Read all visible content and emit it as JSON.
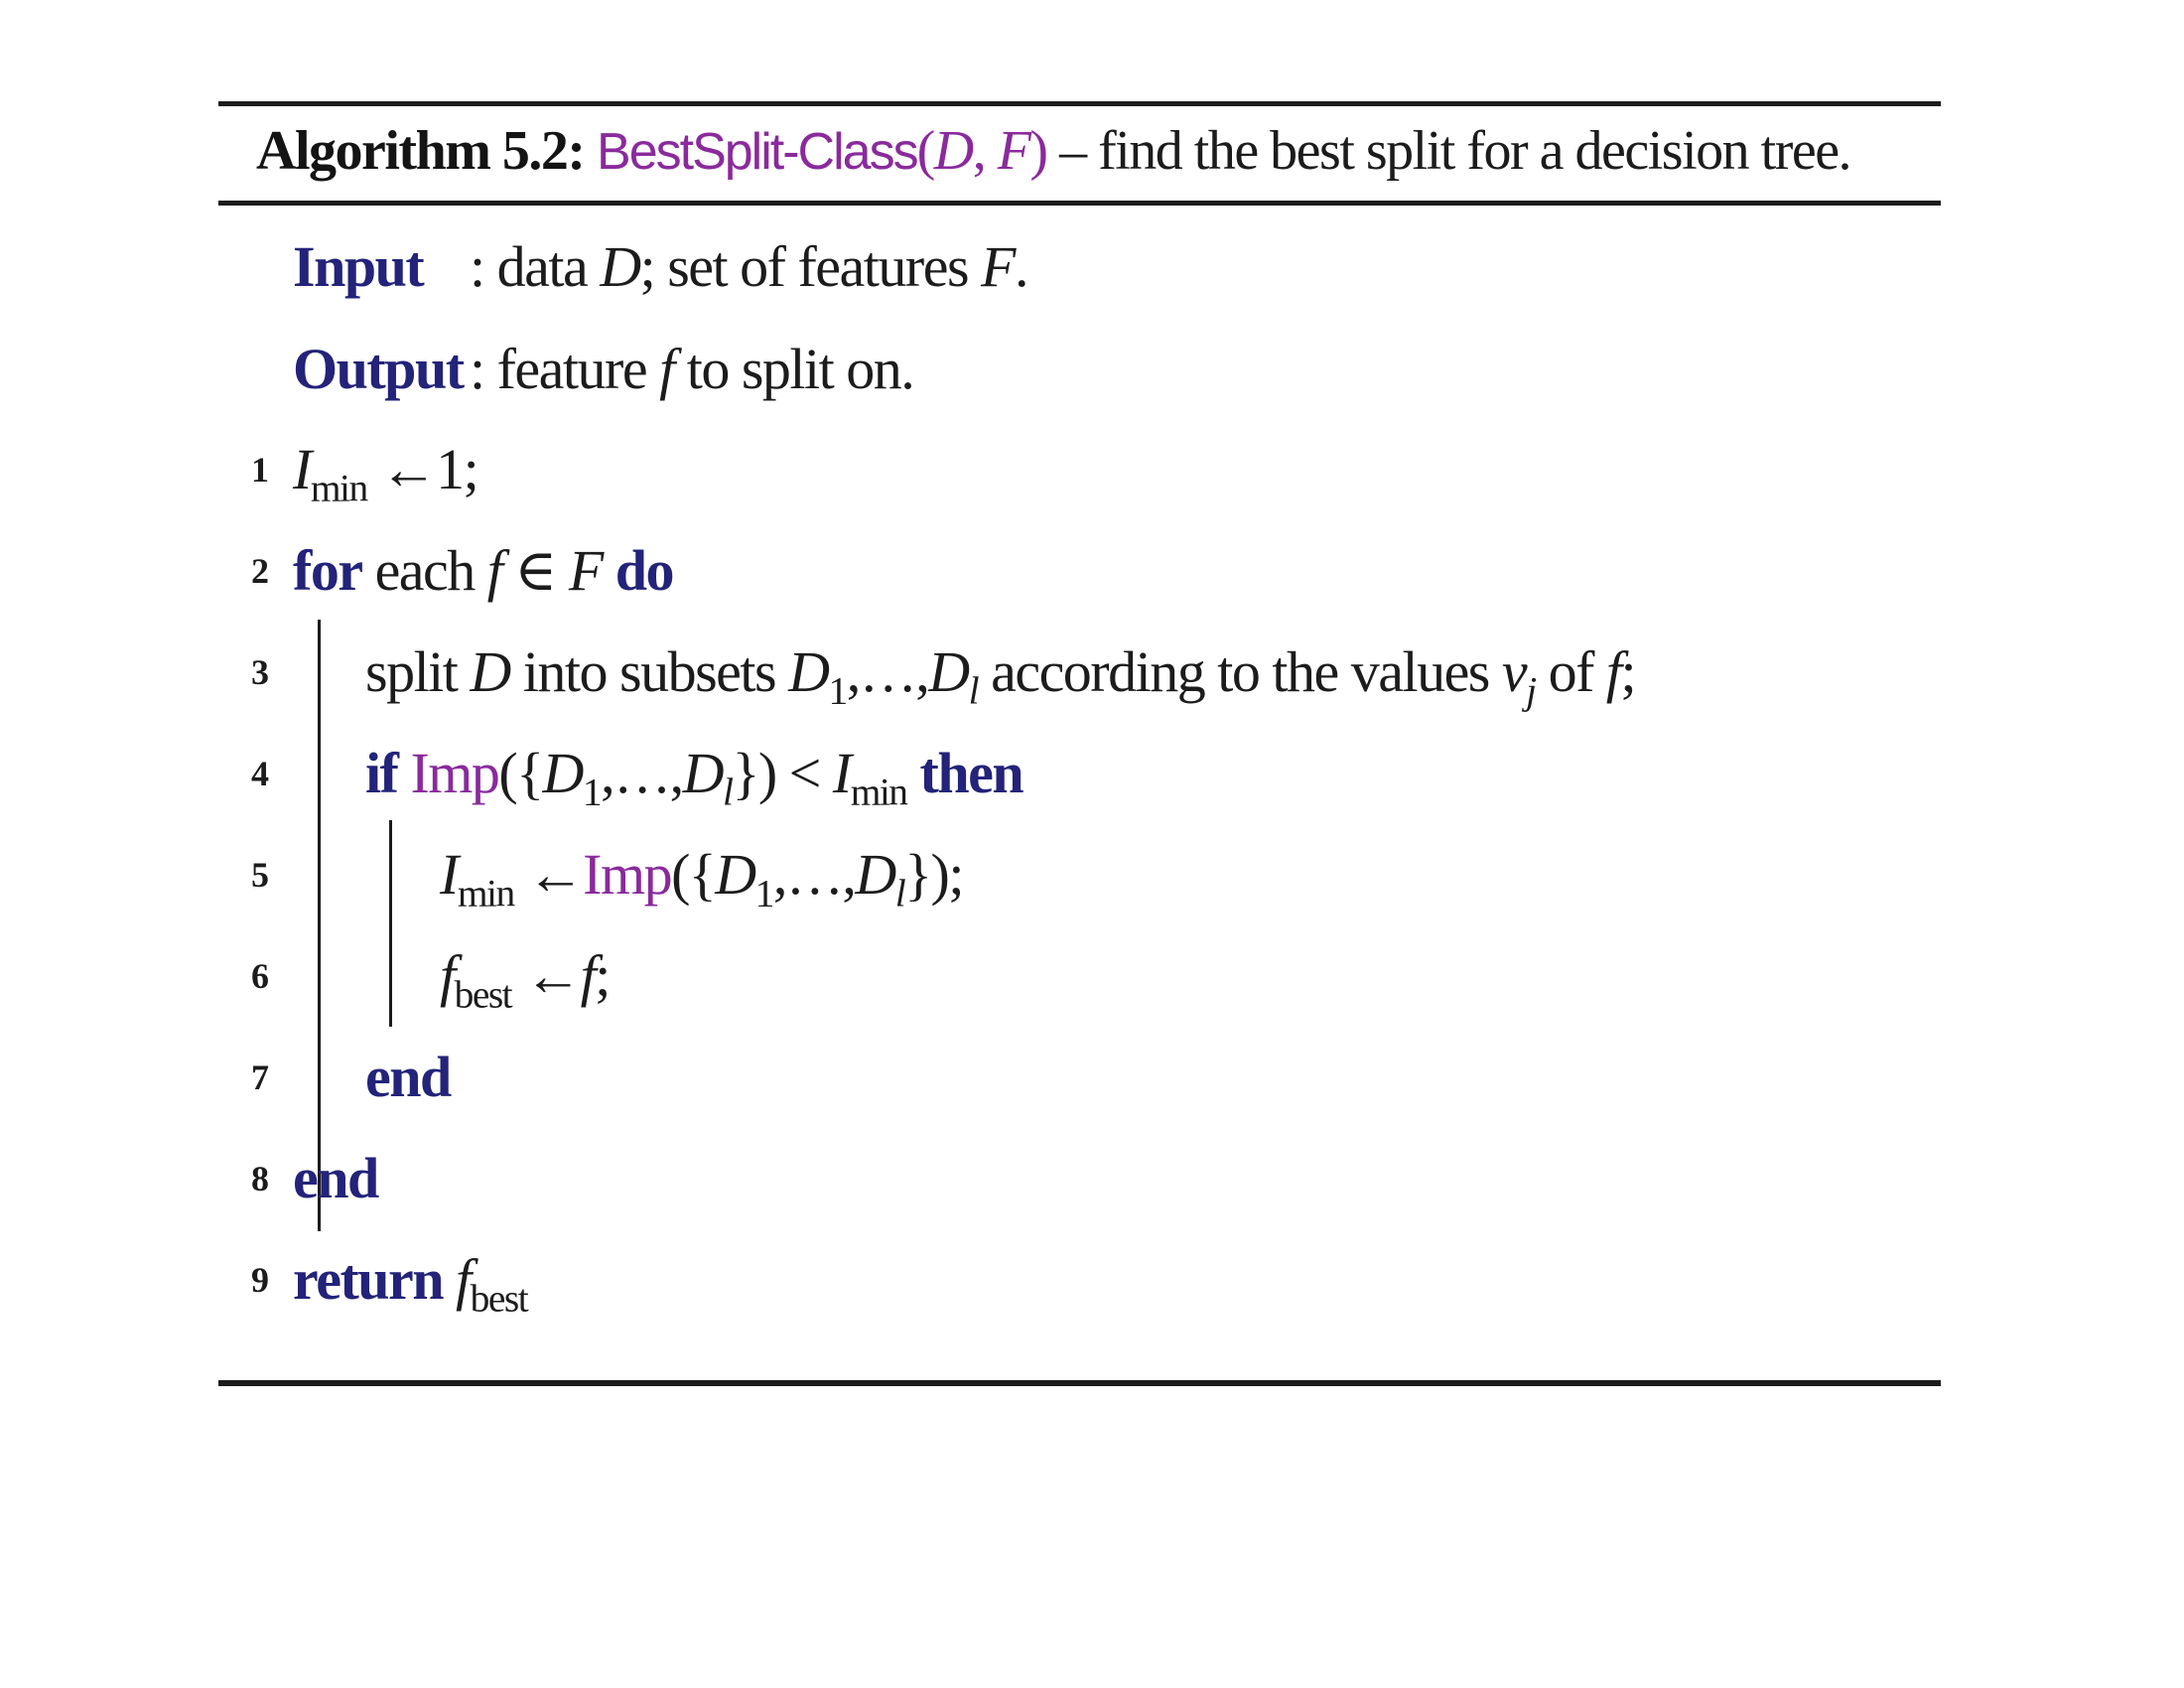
{
  "algorithm": {
    "label": "Algorithm 5.2:",
    "function_name": "BestSplit-Class",
    "function_args_open": "(",
    "arg_D": "D",
    "arg_sep": ", ",
    "arg_F": "F",
    "function_args_close": ")",
    "description": " – find the best split for a decision tree."
  },
  "input": {
    "keyword": "Input",
    "text_a": ": data ",
    "var_D": "D",
    "text_b": "; set of features ",
    "var_F": "F",
    "text_c": "."
  },
  "output": {
    "keyword": "Output",
    "text_a": ": feature ",
    "var_f": "f",
    "text_b": " to split on."
  },
  "lines": [
    {
      "num": "1"
    },
    {
      "num": "2"
    },
    {
      "num": "3"
    },
    {
      "num": "4"
    },
    {
      "num": "5"
    },
    {
      "num": "6"
    },
    {
      "num": "7"
    },
    {
      "num": "8"
    },
    {
      "num": "9"
    }
  ],
  "code": {
    "l1": {
      "var": "I",
      "sub": "min",
      "assign": " ←1;"
    },
    "l2": {
      "kw_for": "for",
      "text": " each ",
      "var_f": "f",
      "in": " ∈ ",
      "var_F": "F",
      "kw_do": " do"
    },
    "l3": {
      "text_a": "split ",
      "var_D": "D",
      "text_b": " into subsets ",
      "var_D1": "D",
      "sub1": "1",
      "dots": ",…,",
      "var_Dl": "D",
      "subl": "l",
      "text_c": " according to the values ",
      "var_v": "v",
      "subj": "j",
      "text_d": " of ",
      "var_f": "f",
      "text_e": ";"
    },
    "l4": {
      "kw_if": "if",
      "fn": " Imp",
      "open": "({",
      "var_D1": "D",
      "sub1": "1",
      "dots": ",…,",
      "var_Dl": "D",
      "subl": "l",
      "close": "}) < ",
      "var_I": "I",
      "sub_min": "min",
      "kw_then": " then"
    },
    "l5": {
      "var_I": "I",
      "sub_min": "min",
      "assign": " ←",
      "fn": "Imp",
      "open": "({",
      "var_D1": "D",
      "sub1": "1",
      "dots": ",…,",
      "var_Dl": "D",
      "subl": "l",
      "close": "});"
    },
    "l6": {
      "var_f": "f",
      "sub_best": "best",
      "assign": " ←",
      "var_f2": "f",
      "end": ";"
    },
    "l7": {
      "kw_end": "end"
    },
    "l8": {
      "kw_end": "end"
    },
    "l9": {
      "kw_return": "return",
      "space": " ",
      "var_f": "f",
      "sub_best": "best"
    }
  }
}
